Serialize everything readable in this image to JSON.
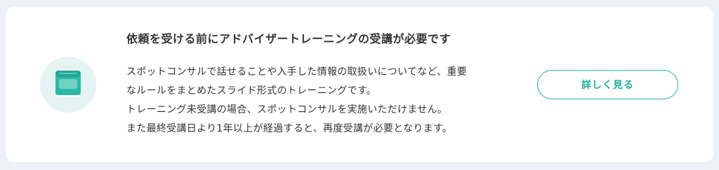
{
  "title": "依頼を受ける前にアドバイザートレーニングの受講が必要です",
  "description": {
    "lines": [
      "スポットコンサルで話せることや入手した情報の取扱いについてなど、重要",
      "なルールをまとめたスライド形式のトレーニングです。",
      "トレーニング未受講の場合、スポットコンサルを実施いただけません。",
      "また最終受講日より1年以上が経過すると、再度受講が必要となります。"
    ]
  },
  "button": {
    "label": "詳しく見る"
  },
  "icon": {
    "name": "book-icon",
    "color": "#2bb9a6"
  },
  "colors": {
    "accent": "#1eaf9e",
    "page_background": "#eef2f8",
    "icon_circle": "#e5f4f3"
  }
}
